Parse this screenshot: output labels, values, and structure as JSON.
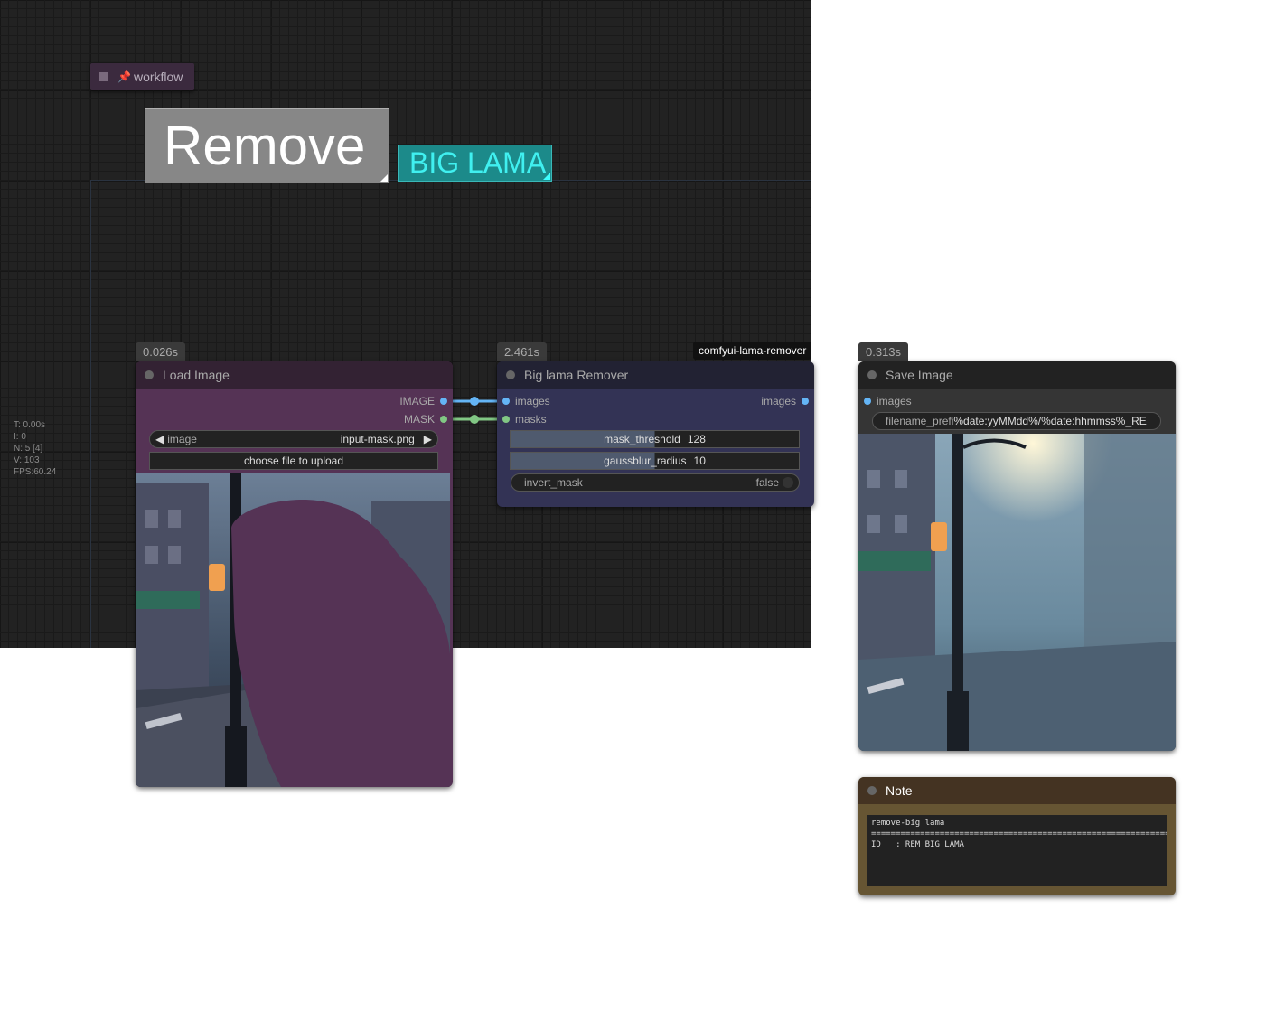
{
  "stats": [
    "T: 0.00s",
    "I: 0",
    "N: 5 [4]",
    "V: 103",
    "FPS:60.24"
  ],
  "workflow_badge": {
    "label": "workflow"
  },
  "labels": {
    "remove": "Remove",
    "big_lama": "BIG LAMA"
  },
  "load_image": {
    "time": "0.026s",
    "title": "Load Image",
    "outputs": [
      "IMAGE",
      "MASK"
    ],
    "image_widget": {
      "name": "image",
      "value": "input-mask.png"
    },
    "upload_button": "choose file to upload"
  },
  "lama_remover": {
    "time": "2.461s",
    "tag": "comfyui-lama-remover",
    "title": "Big lama Remover",
    "inputs": [
      "images",
      "masks"
    ],
    "output": "images",
    "widgets": {
      "mask_threshold": {
        "name": "mask_threshold",
        "value": "128"
      },
      "gaussblur_radius": {
        "name": "gaussblur_radius",
        "value": "10"
      },
      "invert_mask": {
        "name": "invert_mask",
        "value": "false"
      }
    }
  },
  "save_image": {
    "time": "0.313s",
    "title": "Save Image",
    "input": "images",
    "filename_prefix": {
      "name": "filename_prefi",
      "value": "%date:yyMMdd%/%date:hhmmss%_RE"
    }
  },
  "note": {
    "title": "Note",
    "text": "remove-big lama\n=============================================================\nID   : REM_BIG LAMA"
  },
  "colors": {
    "image_link": "#64b5f6",
    "mask_link": "#81c784",
    "load_node": "#553355",
    "lama_node": "#333355",
    "note_node": "#665533"
  }
}
